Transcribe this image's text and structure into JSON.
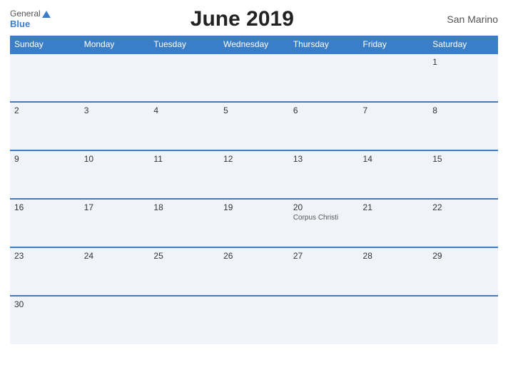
{
  "header": {
    "logo_general": "General",
    "logo_blue": "Blue",
    "title": "June 2019",
    "country": "San Marino"
  },
  "weekdays": [
    "Sunday",
    "Monday",
    "Tuesday",
    "Wednesday",
    "Thursday",
    "Friday",
    "Saturday"
  ],
  "weeks": [
    [
      {
        "day": "",
        "event": ""
      },
      {
        "day": "",
        "event": ""
      },
      {
        "day": "",
        "event": ""
      },
      {
        "day": "",
        "event": ""
      },
      {
        "day": "",
        "event": ""
      },
      {
        "day": "",
        "event": ""
      },
      {
        "day": "1",
        "event": ""
      }
    ],
    [
      {
        "day": "2",
        "event": ""
      },
      {
        "day": "3",
        "event": ""
      },
      {
        "day": "4",
        "event": ""
      },
      {
        "day": "5",
        "event": ""
      },
      {
        "day": "6",
        "event": ""
      },
      {
        "day": "7",
        "event": ""
      },
      {
        "day": "8",
        "event": ""
      }
    ],
    [
      {
        "day": "9",
        "event": ""
      },
      {
        "day": "10",
        "event": ""
      },
      {
        "day": "11",
        "event": ""
      },
      {
        "day": "12",
        "event": ""
      },
      {
        "day": "13",
        "event": ""
      },
      {
        "day": "14",
        "event": ""
      },
      {
        "day": "15",
        "event": ""
      }
    ],
    [
      {
        "day": "16",
        "event": ""
      },
      {
        "day": "17",
        "event": ""
      },
      {
        "day": "18",
        "event": ""
      },
      {
        "day": "19",
        "event": ""
      },
      {
        "day": "20",
        "event": "Corpus Christi"
      },
      {
        "day": "21",
        "event": ""
      },
      {
        "day": "22",
        "event": ""
      }
    ],
    [
      {
        "day": "23",
        "event": ""
      },
      {
        "day": "24",
        "event": ""
      },
      {
        "day": "25",
        "event": ""
      },
      {
        "day": "26",
        "event": ""
      },
      {
        "day": "27",
        "event": ""
      },
      {
        "day": "28",
        "event": ""
      },
      {
        "day": "29",
        "event": ""
      }
    ],
    [
      {
        "day": "30",
        "event": ""
      },
      {
        "day": "",
        "event": ""
      },
      {
        "day": "",
        "event": ""
      },
      {
        "day": "",
        "event": ""
      },
      {
        "day": "",
        "event": ""
      },
      {
        "day": "",
        "event": ""
      },
      {
        "day": "",
        "event": ""
      }
    ]
  ]
}
